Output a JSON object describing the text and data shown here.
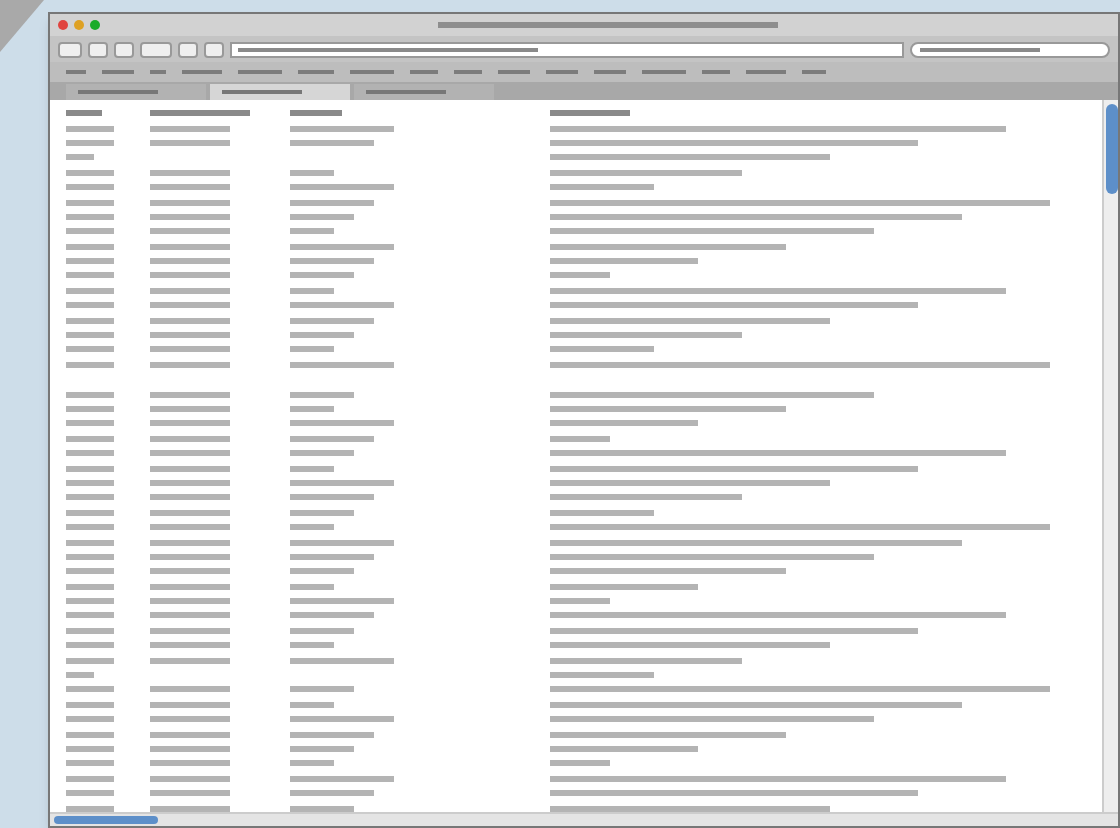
{
  "window": {
    "controls": [
      {
        "color": "#e0443e"
      },
      {
        "color": "#dea123"
      },
      {
        "color": "#1aab29"
      }
    ]
  },
  "tabs": [
    {
      "selected": false
    },
    {
      "selected": true
    },
    {
      "selected": false
    }
  ],
  "rows": [
    {
      "kind": "header"
    },
    {
      "kind": "full"
    },
    {
      "kind": "full"
    },
    {
      "kind": "partial"
    },
    {
      "kind": "full"
    },
    {
      "kind": "full"
    },
    {
      "kind": "full"
    },
    {
      "kind": "full"
    },
    {
      "kind": "full"
    },
    {
      "kind": "full"
    },
    {
      "kind": "full"
    },
    {
      "kind": "full"
    },
    {
      "kind": "full"
    },
    {
      "kind": "full"
    },
    {
      "kind": "full"
    },
    {
      "kind": "full"
    },
    {
      "kind": "full"
    },
    {
      "kind": "full"
    },
    {
      "kind": "empty"
    },
    {
      "kind": "full"
    },
    {
      "kind": "full"
    },
    {
      "kind": "full"
    },
    {
      "kind": "full"
    },
    {
      "kind": "full"
    },
    {
      "kind": "full"
    },
    {
      "kind": "full"
    },
    {
      "kind": "full"
    },
    {
      "kind": "full"
    },
    {
      "kind": "full"
    },
    {
      "kind": "full"
    },
    {
      "kind": "full"
    },
    {
      "kind": "full"
    },
    {
      "kind": "full"
    },
    {
      "kind": "full"
    },
    {
      "kind": "full"
    },
    {
      "kind": "full"
    },
    {
      "kind": "full"
    },
    {
      "kind": "full"
    },
    {
      "kind": "partial"
    },
    {
      "kind": "full"
    },
    {
      "kind": "full"
    },
    {
      "kind": "full"
    },
    {
      "kind": "full"
    },
    {
      "kind": "full"
    },
    {
      "kind": "full"
    },
    {
      "kind": "full"
    },
    {
      "kind": "full"
    },
    {
      "kind": "full"
    }
  ]
}
